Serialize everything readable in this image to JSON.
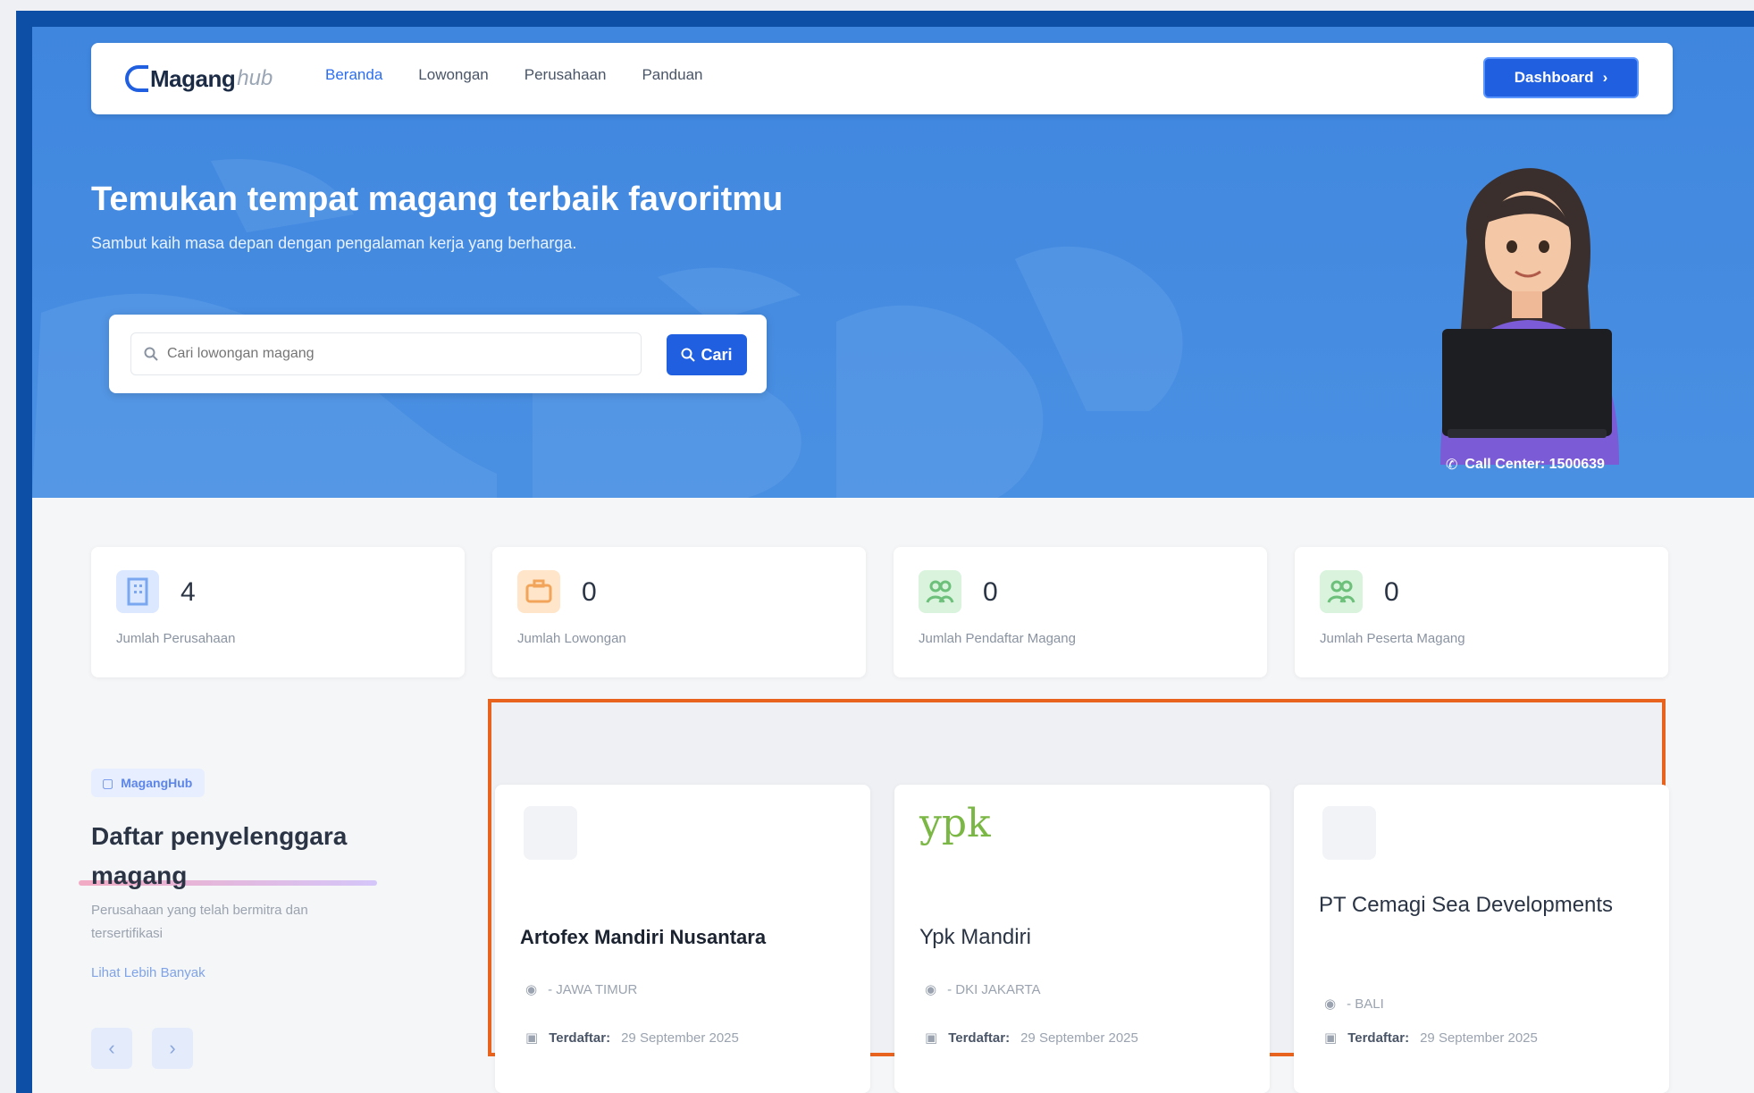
{
  "nav": {
    "logo_main": "Magang",
    "logo_suffix": "hub",
    "links": [
      "Beranda",
      "Lowongan",
      "Perusahaan",
      "Panduan"
    ],
    "dashboard_label": "Dashboard",
    "dashboard_icon": "arrow-right-icon"
  },
  "hero": {
    "title": "Temukan tempat magang terbaik favoritmu",
    "subtitle": "Sambut kaih masa depan dengan pengalaman kerja yang berharga.",
    "search_placeholder": "Cari lowongan magang",
    "search_button": "Cari",
    "call_center": "Call Center: 1500639"
  },
  "stats": [
    {
      "value": "4",
      "label": "Jumlah Perusahaan",
      "color": "#dbe8ff",
      "icon": "building-icon"
    },
    {
      "value": "0",
      "label": "Jumlah Lowongan",
      "color": "#ffe5c9",
      "icon": "briefcase-icon"
    },
    {
      "value": "0",
      "label": "Jumlah Pendaftar Magang",
      "color": "#d9f3dd",
      "icon": "users-icon"
    },
    {
      "value": "0",
      "label": "Jumlah Peserta Magang",
      "color": "#d9f3dd",
      "icon": "users-icon"
    }
  ],
  "section": {
    "badge": "MagangHub",
    "title": "Daftar penyelenggara magang",
    "description": "Perusahaan yang telah bermitra dan tersertifikasi",
    "see_more": "Lihat Lebih Banyak",
    "prev": "‹",
    "next": "›"
  },
  "companies": [
    {
      "name": "Artofex Mandiri Nusantara",
      "location": "- JAWA TIMUR",
      "date_label": "Terdaftar:",
      "date": "29 September 2025"
    },
    {
      "name": "Ypk Mandiri",
      "logo_text": "ypk",
      "location": "- DKI JAKARTA",
      "date_label": "Terdaftar:",
      "date": "29 September 2025"
    },
    {
      "name": "PT Cemagi Sea Developments",
      "location": "- BALI",
      "date_label": "Terdaftar:",
      "date": "29 September 2025"
    }
  ],
  "colors": {
    "primary": "#1f5fe0",
    "hero": "#4a90e2",
    "highlight": "#e8641e"
  }
}
